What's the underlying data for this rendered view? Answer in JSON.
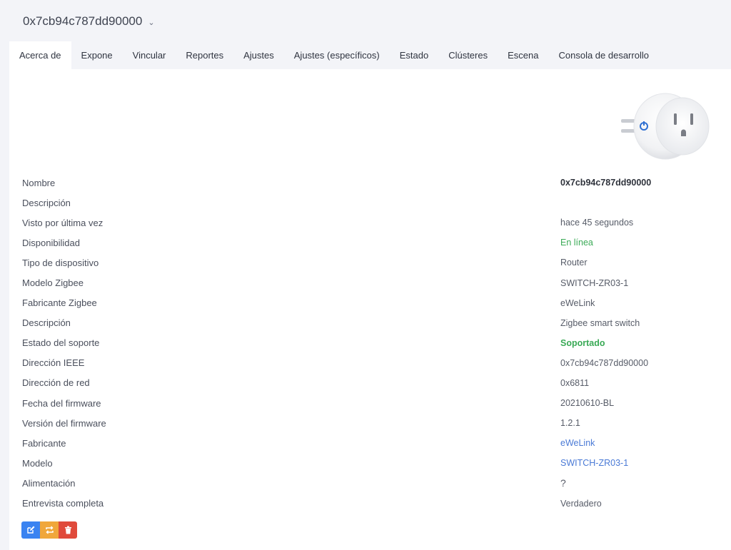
{
  "header": {
    "device_id": "0x7cb94c787dd90000"
  },
  "tabs": [
    {
      "label": "Acerca de",
      "active": true
    },
    {
      "label": "Expone"
    },
    {
      "label": "Vincular"
    },
    {
      "label": "Reportes"
    },
    {
      "label": "Ajustes"
    },
    {
      "label": "Ajustes (específicos)"
    },
    {
      "label": "Estado"
    },
    {
      "label": "Clústeres"
    },
    {
      "label": "Escena"
    },
    {
      "label": "Consola de desarrollo"
    }
  ],
  "details": [
    {
      "label": "Nombre",
      "value": "0x7cb94c787dd90000"
    },
    {
      "label": "Descripción",
      "value": ""
    },
    {
      "label": "Visto por última vez",
      "value": "hace 45 segundos"
    },
    {
      "label": "Disponibilidad",
      "value": "En línea"
    },
    {
      "label": "Tipo de dispositivo",
      "value": "Router"
    },
    {
      "label": "Modelo Zigbee",
      "value": "SWITCH-ZR03-1"
    },
    {
      "label": "Fabricante Zigbee",
      "value": "eWeLink"
    },
    {
      "label": "Descripción",
      "value": "Zigbee smart switch"
    },
    {
      "label": "Estado del soporte",
      "value": "Soportado"
    },
    {
      "label": "Dirección IEEE",
      "value": "0x7cb94c787dd90000"
    },
    {
      "label": "Dirección de red",
      "value": "0x6811"
    },
    {
      "label": "Fecha del firmware",
      "value": "20210610-BL"
    },
    {
      "label": "Versión del firmware",
      "value": "1.2.1"
    },
    {
      "label": "Fabricante",
      "value": "eWeLink"
    },
    {
      "label": "Modelo",
      "value": "SWITCH-ZR03-1"
    },
    {
      "label": "Alimentación",
      "value": "?"
    },
    {
      "label": "Entrevista completa",
      "value": "Verdadero"
    }
  ],
  "actions": {
    "edit_icon": "edit-icon",
    "reconfigure_icon": "refresh-icon",
    "delete_icon": "trash-icon"
  },
  "colors": {
    "online": "#3aaa56",
    "link": "#4a7ad6",
    "edit": "#3a83f1",
    "reconfigure": "#f0a73b",
    "delete": "#e04a3b"
  }
}
